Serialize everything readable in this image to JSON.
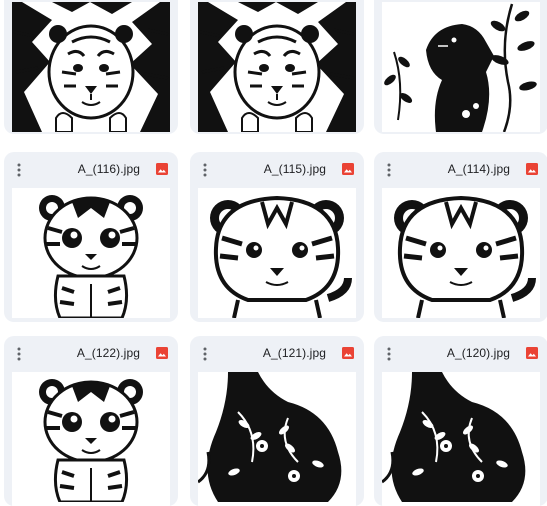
{
  "colors": {
    "card_bg": "#eef1f6",
    "image_icon_red": "#ea4335",
    "text": "#202124",
    "icon_gray": "#5f6368"
  },
  "grid": {
    "row1": [
      {
        "icon": "image-file-icon",
        "subject": "tiger-breaking-wall"
      },
      {
        "icon": "image-file-icon",
        "subject": "tiger-breaking-wall"
      },
      {
        "icon": "image-file-icon",
        "subject": "panther-with-leaves"
      }
    ],
    "row2": [
      {
        "filename": "A_(116).jpg",
        "icon": "image-file-icon",
        "subject": "cartoon-tiger-cub"
      },
      {
        "filename": "A_(115).jpg",
        "icon": "image-file-icon",
        "subject": "cartoon-tiger-face"
      },
      {
        "filename": "A_(114).jpg",
        "icon": "image-file-icon",
        "subject": "cartoon-tiger-face"
      }
    ],
    "row3": [
      {
        "filename": "A_(122).jpg",
        "icon": "image-file-icon",
        "subject": "cartoon-tiger-cub"
      },
      {
        "filename": "A_(121).jpg",
        "icon": "image-file-icon",
        "subject": "floral-tiger-silhouette"
      },
      {
        "filename": "A_(120).jpg",
        "icon": "image-file-icon",
        "subject": "floral-tiger-silhouette"
      }
    ]
  }
}
